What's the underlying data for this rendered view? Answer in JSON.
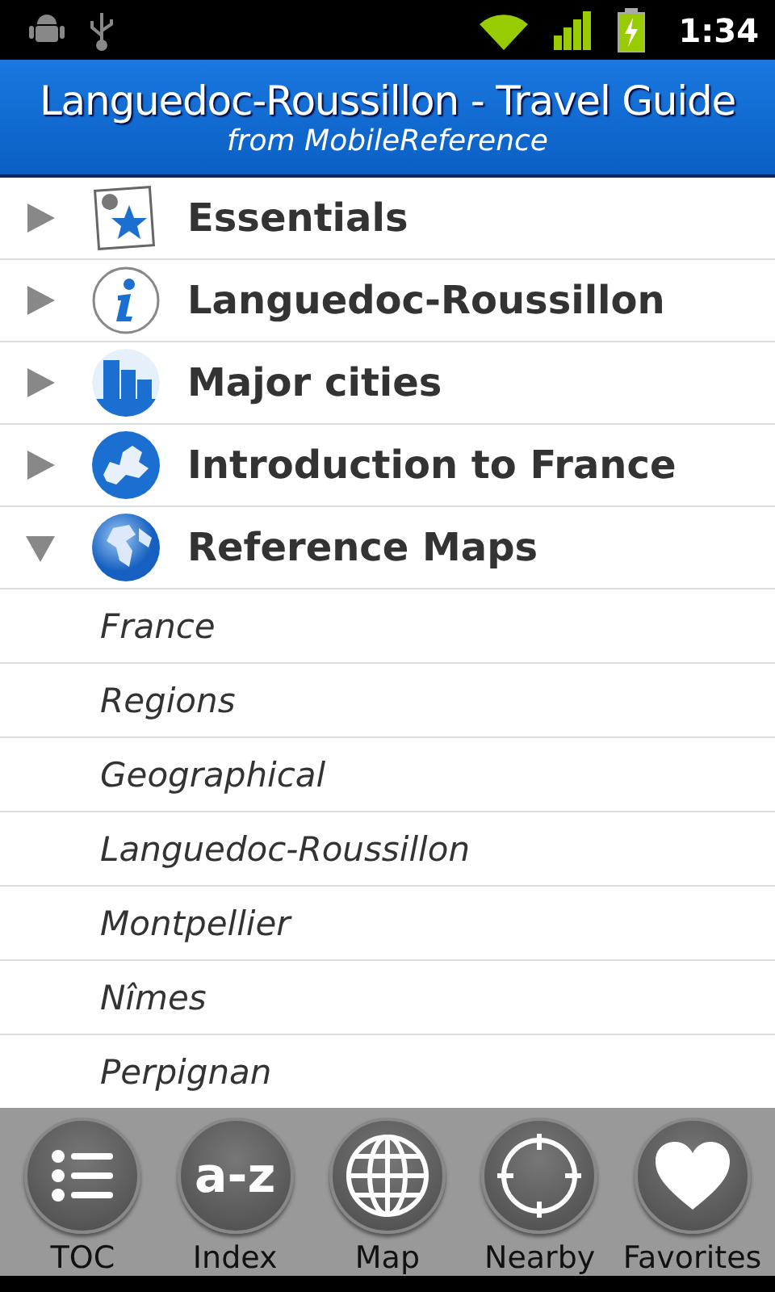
{
  "status_bar": {
    "time": "1:34"
  },
  "header": {
    "title": "Languedoc-Roussillon - Travel Guide",
    "subtitle": "from MobileReference"
  },
  "toc": [
    {
      "label": "Essentials",
      "kind": "star-photo",
      "expanded": false
    },
    {
      "label": "Languedoc-Roussillon",
      "kind": "info",
      "expanded": false
    },
    {
      "label": "Major cities",
      "kind": "city",
      "expanded": false
    },
    {
      "label": "Introduction to France",
      "kind": "europe",
      "expanded": false
    },
    {
      "label": "Reference Maps",
      "kind": "globe",
      "expanded": true,
      "children": [
        {
          "label": "France"
        },
        {
          "label": "Regions"
        },
        {
          "label": "Geographical"
        },
        {
          "label": "Languedoc-Roussillon"
        },
        {
          "label": "Montpellier"
        },
        {
          "label": "Nîmes"
        },
        {
          "label": "Perpignan"
        }
      ]
    }
  ],
  "bottom_bar": [
    {
      "label": "TOC",
      "kind": "list"
    },
    {
      "label": "Index",
      "kind": "glyph",
      "glyph": "a-z"
    },
    {
      "label": "Map",
      "kind": "globe"
    },
    {
      "label": "Nearby",
      "kind": "target"
    },
    {
      "label": "Favorites",
      "kind": "heart"
    }
  ]
}
